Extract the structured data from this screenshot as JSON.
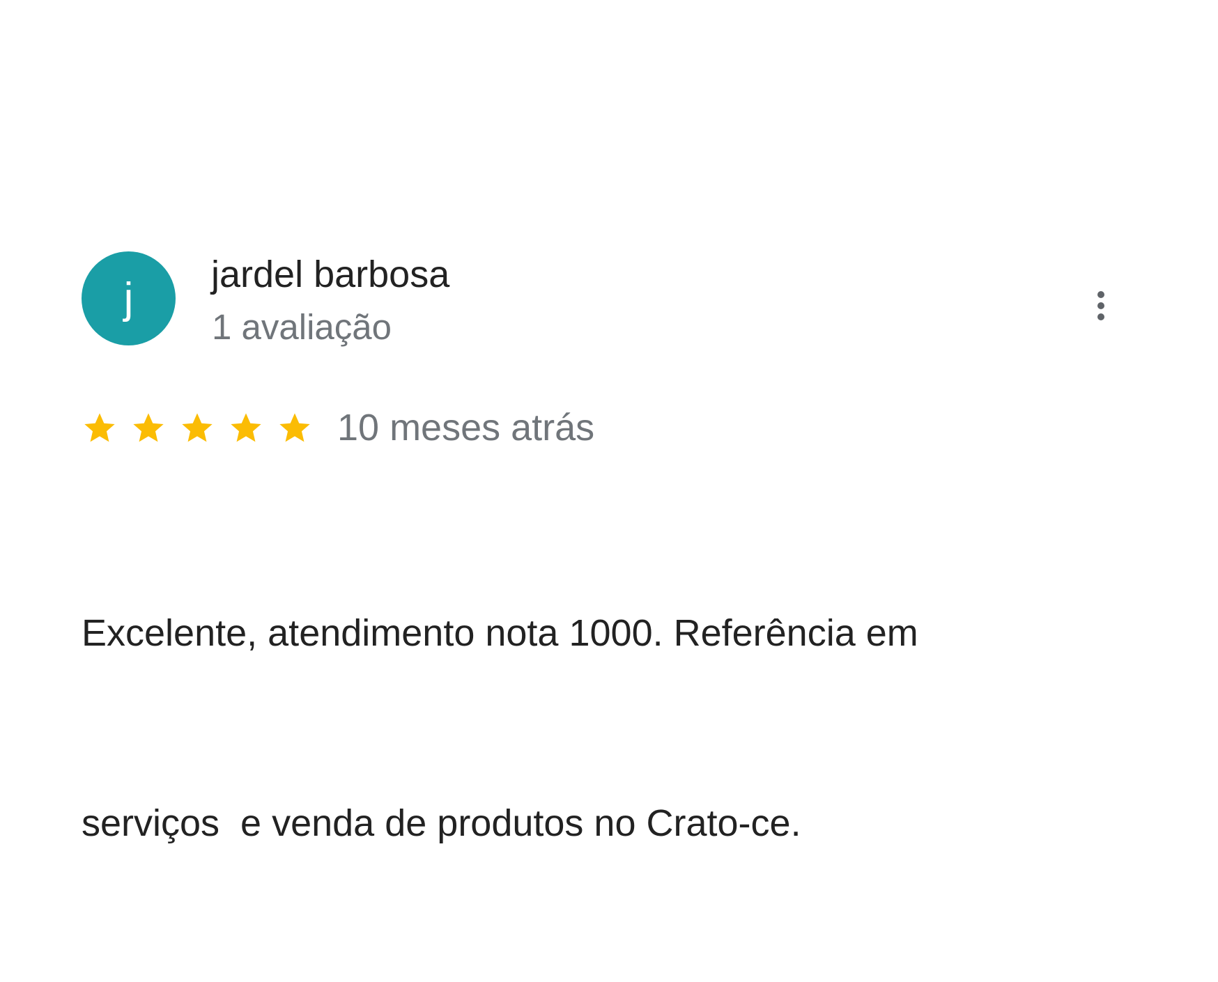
{
  "review": {
    "avatar_letter": "j",
    "avatar_color": "#1a9ea6",
    "author_name": "jardel barbosa",
    "review_count": "1 avaliação",
    "rating": 5,
    "rating_max": 5,
    "star_color": "#fbbc04",
    "date": "10 meses atrás",
    "text_lines": [
      "Excelente, atendimento nota 1000. Referência em",
      "serviços  e venda de produtos no Crato-ce."
    ]
  },
  "icons": {
    "more_options": "more-vert-icon",
    "star": "star-icon"
  }
}
